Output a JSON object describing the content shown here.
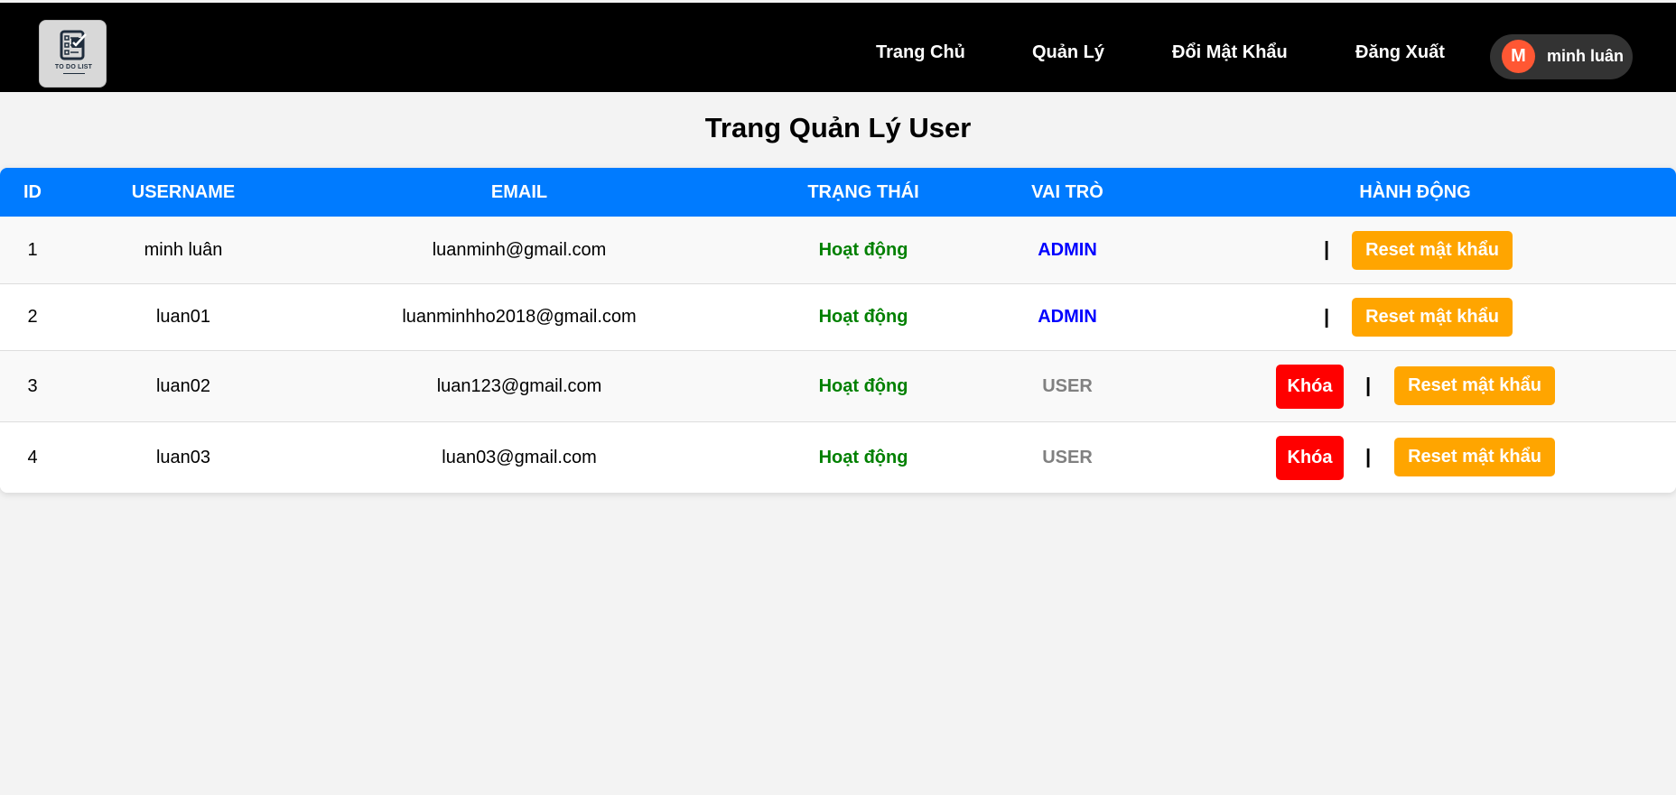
{
  "header": {
    "logo_text": "TO DO LIST",
    "nav": {
      "home": "Trang Chủ",
      "manage": "Quản Lý",
      "change_password": "Đổi Mật Khẩu",
      "logout": "Đăng Xuất"
    },
    "user": {
      "initial": "M",
      "name": "minh luân"
    }
  },
  "page_title": "Trang Quản Lý User",
  "table": {
    "headers": {
      "id": "ID",
      "username": "USERNAME",
      "email": "EMAIL",
      "status": "TRẠNG THÁI",
      "role": "VAI TRÒ",
      "action": "HÀNH ĐỘNG"
    },
    "rows": [
      {
        "id": "1",
        "username": "minh luân",
        "email": "luanminh@gmail.com",
        "status": "Hoạt động",
        "role": "ADMIN",
        "separator": "|",
        "reset_label": "Reset mật khẩu"
      },
      {
        "id": "2",
        "username": "luan01",
        "email": "luanminhho2018@gmail.com",
        "status": "Hoạt động",
        "role": "ADMIN",
        "separator": "|",
        "reset_label": "Reset mật khẩu"
      },
      {
        "id": "3",
        "username": "luan02",
        "email": "luan123@gmail.com",
        "status": "Hoạt động",
        "role": "USER",
        "lock_label": "Khóa",
        "separator": "|",
        "reset_label": "Reset mật khẩu"
      },
      {
        "id": "4",
        "username": "luan03",
        "email": "luan03@gmail.com",
        "status": "Hoạt động",
        "role": "USER",
        "lock_label": "Khóa",
        "separator": "|",
        "reset_label": "Reset mật khẩu"
      }
    ]
  },
  "colors": {
    "header_bg": "#000000",
    "table_header_bg": "#007bff",
    "status_active": "#008000",
    "role_admin": "#0000ff",
    "role_user": "#808080",
    "lock_button": "#ff0000",
    "reset_button": "#ffa500",
    "avatar_bg": "#ff5733"
  }
}
